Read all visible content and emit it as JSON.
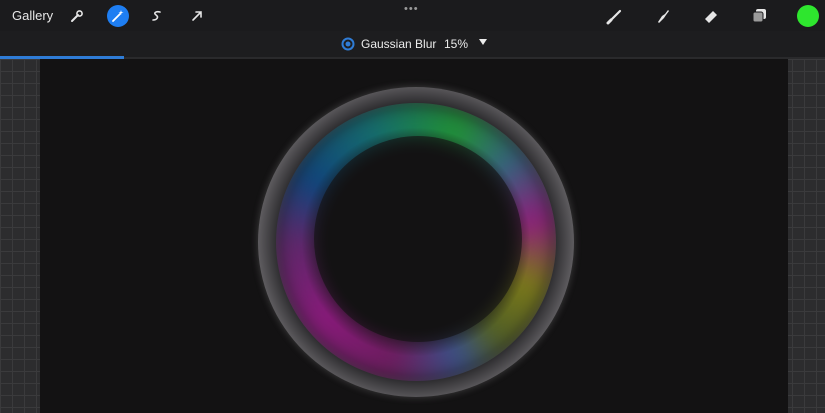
{
  "toolbar": {
    "gallery_label": "Gallery",
    "left_icons": [
      "wrench-icon",
      "magic-wand-icon",
      "selection-icon",
      "transform-arrow-icon"
    ],
    "active_tool": "magic-wand-icon",
    "more_label": "•••",
    "right_icons": [
      "brush-icon",
      "smudge-icon",
      "eraser-icon",
      "layers-icon"
    ],
    "current_color": "#2ee62e"
  },
  "adjustment": {
    "name": "Gaussian Blur",
    "value": "15%",
    "progress_fraction": 0.15
  },
  "colors": {
    "accent": "#1e7ef2",
    "canvas": "#131213"
  }
}
